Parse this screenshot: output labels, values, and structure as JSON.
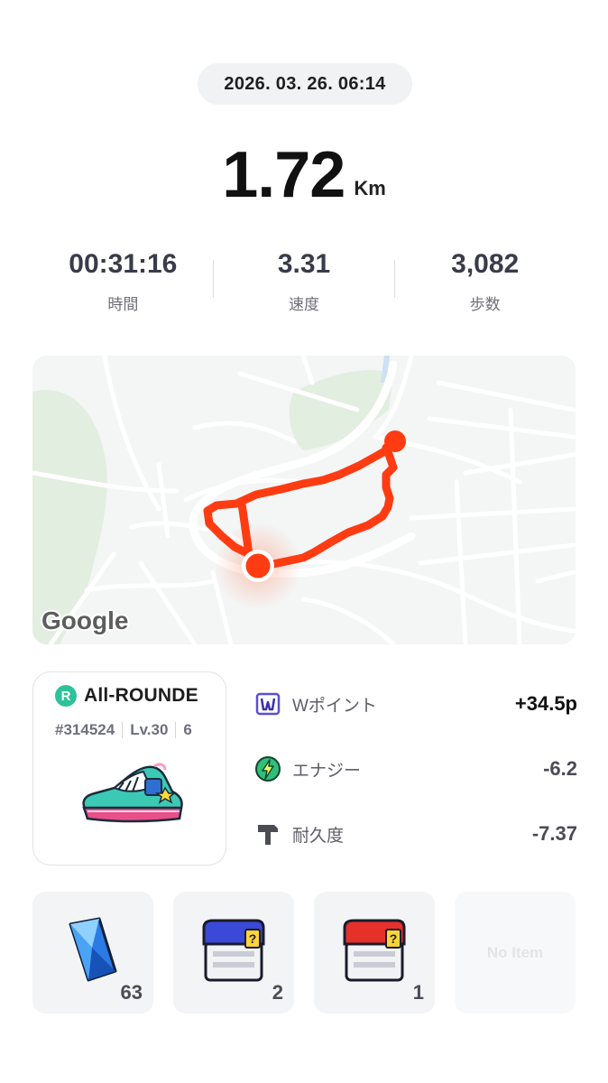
{
  "header": {
    "datetime": "2026. 03. 26. 06:14"
  },
  "distance": {
    "value": "1.72",
    "unit": "Km"
  },
  "stats": [
    {
      "value": "00:31:16",
      "label": "時間"
    },
    {
      "value": "3.31",
      "label": "速度"
    },
    {
      "value": "3,082",
      "label": "歩数"
    }
  ],
  "map": {
    "attribution": "Google",
    "route_color": "#ff3b12"
  },
  "shoe": {
    "rarity_letter": "R",
    "name": "All-ROUNDE",
    "id": "#314524",
    "level": "Lv.30",
    "extra": "6",
    "badge_color": "#2ec29a"
  },
  "rewards": [
    {
      "icon": "w-point-icon",
      "label": "Wポイント",
      "value": "+34.5p"
    },
    {
      "icon": "energy-bolt-icon",
      "label": "エナジー",
      "value": "-6.2"
    },
    {
      "icon": "durability-hammer-icon",
      "label": "耐久度",
      "value": "-7.37"
    }
  ],
  "items": [
    {
      "icon": "blue-gem-icon",
      "count": "63"
    },
    {
      "icon": "blue-mystery-box-icon",
      "count": "2"
    },
    {
      "icon": "red-mystery-box-icon",
      "count": "1"
    },
    {
      "icon": "empty-slot",
      "empty_label": "No Item"
    }
  ]
}
